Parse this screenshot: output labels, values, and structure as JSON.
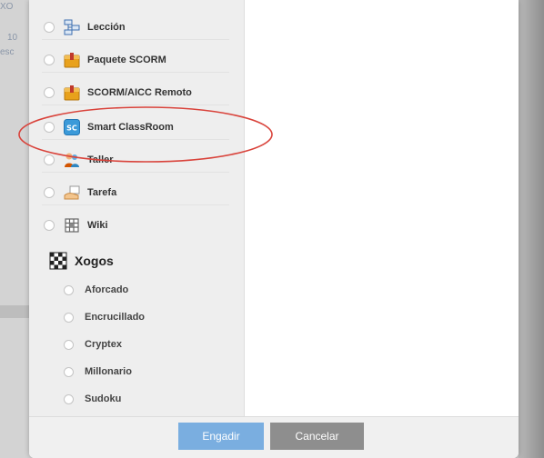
{
  "background": {
    "fragments": [
      "XO",
      "10",
      "esc"
    ]
  },
  "modules": [
    {
      "name": "leccion",
      "label": "Lección",
      "icon": "lesson-flowchart-icon"
    },
    {
      "name": "paquete-scorm",
      "label": "Paquete SCORM",
      "icon": "package-box-icon"
    },
    {
      "name": "scorm-aicc-remoto",
      "label": "SCORM/AICC Remoto",
      "icon": "package-box-icon"
    },
    {
      "name": "smart-classroom",
      "label": "Smart ClassRoom",
      "icon": "smart-classroom-icon",
      "icon_text": "SC"
    },
    {
      "name": "taller",
      "label": "Taller",
      "icon": "people-workshop-icon"
    },
    {
      "name": "tarefa",
      "label": "Tarefa",
      "icon": "assignment-hand-icon"
    },
    {
      "name": "wiki",
      "label": "Wiki",
      "icon": "wiki-grid-icon"
    }
  ],
  "games": {
    "label": "Xogos",
    "icon": "games-checkerboard-icon",
    "items": [
      {
        "name": "aforcado",
        "label": "Aforcado"
      },
      {
        "name": "encrucillado",
        "label": "Encrucillado"
      },
      {
        "name": "cryptex",
        "label": "Cryptex"
      },
      {
        "name": "millonario",
        "label": "Millonario"
      },
      {
        "name": "sudoku",
        "label": "Sudoku"
      }
    ]
  },
  "footer": {
    "add_label": "Engadir",
    "cancel_label": "Cancelar"
  },
  "colors": {
    "primary_button": "#7aaee0",
    "secondary_button": "#8e8e8e",
    "annotation": "#d9433b",
    "scorm_icon": "#e8a11c",
    "smart_icon": "#3b9ad9"
  }
}
